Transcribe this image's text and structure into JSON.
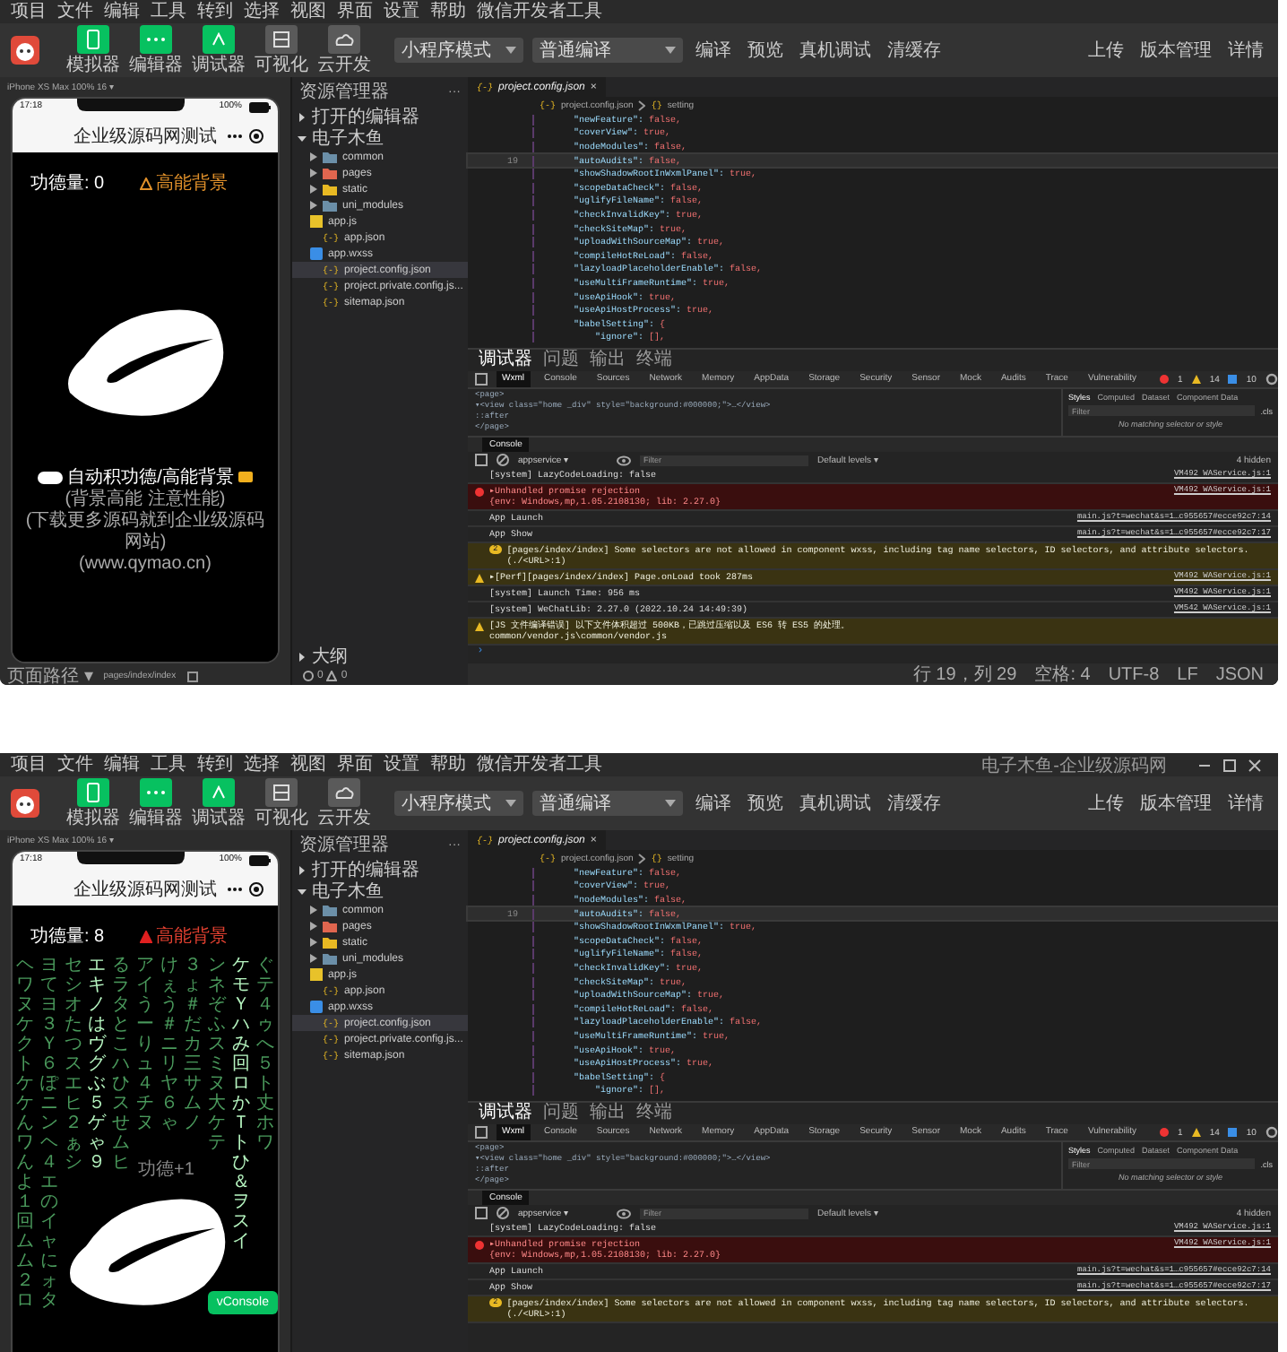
{
  "windows": [
    {
      "menu": [
        "项目",
        "文件",
        "编辑",
        "工具",
        "转到",
        "选择",
        "视图",
        "界面",
        "设置",
        "帮助",
        "微信开发者工具"
      ],
      "tools": [
        {
          "label": "模拟器",
          "on": true
        },
        {
          "label": "编辑器",
          "on": true
        },
        {
          "label": "调试器",
          "on": true
        },
        {
          "label": "可视化",
          "on": false
        },
        {
          "label": "云开发",
          "on": false
        }
      ],
      "mode": "小程序模式",
      "compile": "普通编译",
      "actions": [
        "编译",
        "预览",
        "真机调试",
        "清缓存"
      ],
      "right_actions": [
        "上传",
        "版本管理",
        "详情"
      ],
      "simulator": {
        "device": "iPhone XS Max 100% 16 ▾",
        "time": "17:18",
        "battery": "100%",
        "nav_title": "企业级源码网测试",
        "merit": "功德量: 0",
        "bg_button": "高能背景",
        "caption": "自动积功德/高能背景",
        "caption_lines": [
          "(背景高能 注意性能)",
          "(下载更多源码就到企业级源码网站)",
          "(www.qymao.cn)"
        ],
        "path_label": "页面路径 ▾",
        "path": "pages/index/index"
      },
      "explorer": {
        "title": "资源管理器",
        "more": "···",
        "sections": [
          {
            "label": "打开的编辑器",
            "expanded": false
          },
          {
            "label": "电子木鱼",
            "expanded": true
          }
        ],
        "items": [
          {
            "name": "common",
            "kind": "folder",
            "color": "#6b8fa8",
            "selected": false
          },
          {
            "name": "pages",
            "kind": "folder",
            "color": "#e0664f",
            "selected": false
          },
          {
            "name": "static",
            "kind": "folder",
            "color": "#e8b923",
            "selected": false
          },
          {
            "name": "uni_modules",
            "kind": "folder",
            "color": "#6b8fa8",
            "selected": false
          },
          {
            "name": "app.js",
            "kind": "js",
            "selected": false
          },
          {
            "name": "app.json",
            "kind": "json",
            "glyph": "{-}",
            "selected": false
          },
          {
            "name": "app.wxss",
            "kind": "wxss",
            "selected": false
          },
          {
            "name": "project.config.json",
            "kind": "json",
            "glyph": "{-}",
            "selected": true
          },
          {
            "name": "project.private.config.js...",
            "kind": "json",
            "glyph": "{-}",
            "selected": false
          },
          {
            "name": "sitemap.json",
            "kind": "json",
            "glyph": "{-}",
            "selected": false
          }
        ],
        "outline": "大纲",
        "problems": [
          "0",
          "0"
        ]
      },
      "editor": {
        "tab": {
          "glyph": "{-}",
          "label": "project.config.json",
          "close": "×"
        },
        "breadcrumb": [
          {
            "glyph": "{-}",
            "label": "project.config.json"
          },
          {
            "glyph": "{}",
            "label": "setting"
          }
        ],
        "lines": [
          {
            "key": "\"newFeature\":",
            "value": "false,",
            "current": false
          },
          {
            "key": "\"coverView\":",
            "value": "true,",
            "current": false
          },
          {
            "key": "\"nodeModules\":",
            "value": "false,",
            "current": false
          },
          {
            "key": "\"autoAudits\":",
            "value": "false,",
            "current": true,
            "number": "19"
          },
          {
            "key": "\"showShadowRootInWxmlPanel\":",
            "value": "true,",
            "current": false
          },
          {
            "key": "\"scopeDataCheck\":",
            "value": "false,",
            "current": false
          },
          {
            "key": "\"uglifyFileName\":",
            "value": "false,",
            "current": false
          },
          {
            "key": "\"checkInvalidKey\":",
            "value": "true,",
            "current": false
          },
          {
            "key": "\"checkSiteMap\":",
            "value": "true,",
            "current": false
          },
          {
            "key": "\"uploadWithSourceMap\":",
            "value": "true,",
            "current": false
          },
          {
            "key": "\"compileHotReLoad\":",
            "value": "false,",
            "current": false
          },
          {
            "key": "\"lazyloadPlaceholderEnable\":",
            "value": "false,",
            "current": false
          },
          {
            "key": "\"useMultiFrameRuntime\":",
            "value": "true,",
            "current": false
          },
          {
            "key": "\"useApiHook\":",
            "value": "true,",
            "current": false
          },
          {
            "key": "\"useApiHostProcess\":",
            "value": "true,",
            "current": false
          },
          {
            "key": "\"babelSetting\":",
            "value": "{",
            "current": false,
            "children": [
              {
                "key": "\"ignore\":",
                "value": "[],",
                "current": false
              }
            ]
          }
        ]
      },
      "devtools": {
        "tabs": [
          {
            "label": "调试器",
            "selected": true
          },
          {
            "label": "问题",
            "selected": false
          },
          {
            "label": "输出",
            "selected": false
          },
          {
            "label": "终端",
            "selected": false
          }
        ],
        "panels": [
          {
            "label": "Wxml",
            "selected": true
          },
          {
            "label": "Console",
            "selected": false
          },
          {
            "label": "Sources",
            "selected": false
          },
          {
            "label": "Network",
            "selected": false
          },
          {
            "label": "Memory",
            "selected": false
          },
          {
            "label": "AppData",
            "selected": false
          },
          {
            "label": "Storage",
            "selected": false
          },
          {
            "label": "Security",
            "selected": false
          },
          {
            "label": "Sensor",
            "selected": false
          },
          {
            "label": "Mock",
            "selected": false
          },
          {
            "label": "Audits",
            "selected": false
          },
          {
            "label": "Trace",
            "selected": false
          },
          {
            "label": "Vulnerability",
            "selected": false
          }
        ],
        "counts": [
          "1",
          "14",
          "10"
        ],
        "wxml": [
          "<page>",
          "▾<view class=\"home _div\" style=\"background:#000000;\">…</view>",
          "::after",
          "</page>"
        ],
        "style_tabs": [
          {
            "label": "Styles",
            "selected": true
          },
          {
            "label": "Computed",
            "selected": false
          },
          {
            "label": "Dataset",
            "selected": false
          },
          {
            "label": "Component Data",
            "selected": false
          }
        ],
        "style_filter": {
          "placeholder": "Filter"
        },
        "cls": ".cls",
        "no_match": "No matching selector or style",
        "console_tab": "Console",
        "context": "appservice ▾",
        "filter": {
          "placeholder": "Filter"
        },
        "levels": "Default levels ▾",
        "hidden": "4 hidden",
        "messages": [
          {
            "kind": "info",
            "text": "[system] LazyCodeLoading: false",
            "source": "VM492 WAService.js:1"
          },
          {
            "kind": "error",
            "text": "▸Unhandled promise rejection",
            "detail": "{env: Windows,mp,1.05.2108130; lib: 2.27.0}",
            "source": "VM492 WAService.js:1"
          },
          {
            "kind": "info",
            "text": "App Launch",
            "source": "main.js?t=wechat&s=1…c955657#ecce92c7:14"
          },
          {
            "kind": "info",
            "text": "App Show",
            "source": "main.js?t=wechat&s=1…c955657#ecce92c7:17"
          },
          {
            "kind": "warn",
            "badge": "2",
            "text": "[pages/index/index] Some selectors are not allowed in component wxss, including tag name selectors, ID selectors, and attribute selectors.(./<URL>:1)"
          },
          {
            "kind": "warn",
            "text": "▸[Perf][pages/index/index] Page.onLoad took 287ms",
            "source": "VM492 WAService.js:1"
          },
          {
            "kind": "info",
            "text": "[system] Launch Time: 956 ms",
            "source": "VM492 WAService.js:1"
          },
          {
            "kind": "info",
            "text": "[system] WeChatLib: 2.27.0 (2022.10.24 14:49:39)",
            "source": "VM542 WAService.js:1"
          },
          {
            "kind": "warn",
            "text": "[JS 文件编译错误] 以下文件体积超过 500KB，已跳过压缩以及 ES6 转 ES5 的处理。",
            "detail": "common/vendor.js\\common/vendor.js"
          }
        ],
        "prompt": "›"
      },
      "status": [
        "行 19，列 29",
        "空格: 4",
        "UTF-8",
        "LF",
        "JSON"
      ]
    },
    {
      "menu": [
        "项目",
        "文件",
        "编辑",
        "工具",
        "转到",
        "选择",
        "视图",
        "界面",
        "设置",
        "帮助",
        "微信开发者工具"
      ],
      "title": "电子木鱼-企业级源码网",
      "window_controls": true,
      "tools": [
        {
          "label": "模拟器",
          "on": true
        },
        {
          "label": "编辑器",
          "on": true
        },
        {
          "label": "调试器",
          "on": true
        },
        {
          "label": "可视化",
          "on": false
        },
        {
          "label": "云开发",
          "on": false
        }
      ],
      "mode": "小程序模式",
      "compile": "普通编译",
      "actions": [
        "编译",
        "预览",
        "真机调试",
        "清缓存"
      ],
      "right_actions": [
        "上传",
        "版本管理",
        "详情"
      ],
      "simulator": {
        "device": "iPhone XS Max 100% 16 ▾",
        "time": "17:18",
        "battery": "100%",
        "nav_title": "企业级源码网测试",
        "merit": "功德量: 8",
        "bg_button": "高能背景",
        "floating_text": "功德+1",
        "rain": [
          {
            "chars": "ヘワヌケクトケケんワんよ１回ムム２ロ",
            "bright": false
          },
          {
            "chars": "ヨてヨ３Ｙ６ぽニンヘ４エのイャにォタ",
            "bright": false
          },
          {
            "chars": "セシオたつスエヒ２ぁシ",
            "bright": false
          },
          {
            "chars": "エキノはヴグぶ５ゲゃ９",
            "bright": true
          },
          {
            "chars": "るラタとこハひスせムヒ",
            "bright": false
          },
          {
            "chars": "アイうーりュ４チヌ",
            "bright": false
          },
          {
            "chars": "けぇう＃ニリヤ６ゃ",
            "bright": false
          },
          {
            "chars": "３ょ＃だカ三サムノ",
            "bright": false
          },
          {
            "chars": "ンネぞふスミヌ大ケテ",
            "bright": false
          },
          {
            "chars": "ケモＹハみ回ロかＴトひ＆ヲスイ",
            "bright": true
          },
          {
            "chars": "ぐテ４ゥへ５ト丈ホワ",
            "bright": false
          }
        ],
        "vconsole": "vConsole"
      },
      "explorer": {
        "title": "资源管理器",
        "more": "···",
        "sections": [
          {
            "label": "打开的编辑器",
            "expanded": false
          },
          {
            "label": "电子木鱼",
            "expanded": true
          }
        ],
        "items": [
          {
            "name": "common",
            "kind": "folder",
            "color": "#6b8fa8",
            "selected": false
          },
          {
            "name": "pages",
            "kind": "folder",
            "color": "#e0664f",
            "selected": false
          },
          {
            "name": "static",
            "kind": "folder",
            "color": "#e8b923",
            "selected": false
          },
          {
            "name": "uni_modules",
            "kind": "folder",
            "color": "#6b8fa8",
            "selected": false
          },
          {
            "name": "app.js",
            "kind": "js",
            "selected": false
          },
          {
            "name": "app.json",
            "kind": "json",
            "glyph": "{-}",
            "selected": false
          },
          {
            "name": "app.wxss",
            "kind": "wxss",
            "selected": false
          },
          {
            "name": "project.config.json",
            "kind": "json",
            "glyph": "{-}",
            "selected": true
          },
          {
            "name": "project.private.config.js...",
            "kind": "json",
            "glyph": "{-}",
            "selected": false
          },
          {
            "name": "sitemap.json",
            "kind": "json",
            "glyph": "{-}",
            "selected": false
          }
        ]
      },
      "editor": {
        "tab": {
          "glyph": "{-}",
          "label": "project.config.json",
          "close": "×"
        },
        "breadcrumb": [
          {
            "glyph": "{-}",
            "label": "project.config.json"
          },
          {
            "glyph": "{}",
            "label": "setting"
          }
        ],
        "lines": [
          {
            "key": "\"newFeature\":",
            "value": "false,",
            "current": false
          },
          {
            "key": "\"coverView\":",
            "value": "true,",
            "current": false
          },
          {
            "key": "\"nodeModules\":",
            "value": "false,",
            "current": false
          },
          {
            "key": "\"autoAudits\":",
            "value": "false,",
            "current": true,
            "number": "19"
          },
          {
            "key": "\"showShadowRootInWxmlPanel\":",
            "value": "true,",
            "current": false
          },
          {
            "key": "\"scopeDataCheck\":",
            "value": "false,",
            "current": false
          },
          {
            "key": "\"uglifyFileName\":",
            "value": "false,",
            "current": false
          },
          {
            "key": "\"checkInvalidKey\":",
            "value": "true,",
            "current": false
          },
          {
            "key": "\"checkSiteMap\":",
            "value": "true,",
            "current": false
          },
          {
            "key": "\"uploadWithSourceMap\":",
            "value": "true,",
            "current": false
          },
          {
            "key": "\"compileHotReLoad\":",
            "value": "false,",
            "current": false
          },
          {
            "key": "\"lazyloadPlaceholderEnable\":",
            "value": "false,",
            "current": false
          },
          {
            "key": "\"useMultiFrameRuntime\":",
            "value": "true,",
            "current": false
          },
          {
            "key": "\"useApiHook\":",
            "value": "true,",
            "current": false
          },
          {
            "key": "\"useApiHostProcess\":",
            "value": "true,",
            "current": false
          },
          {
            "key": "\"babelSetting\":",
            "value": "{",
            "current": false,
            "children": [
              {
                "key": "\"ignore\":",
                "value": "[],",
                "current": false
              }
            ]
          }
        ]
      },
      "devtools": {
        "tabs": [
          {
            "label": "调试器",
            "selected": true
          },
          {
            "label": "问题",
            "selected": false
          },
          {
            "label": "输出",
            "selected": false
          },
          {
            "label": "终端",
            "selected": false
          }
        ],
        "panels": [
          {
            "label": "Wxml",
            "selected": true
          },
          {
            "label": "Console",
            "selected": false
          },
          {
            "label": "Sources",
            "selected": false
          },
          {
            "label": "Network",
            "selected": false
          },
          {
            "label": "Memory",
            "selected": false
          },
          {
            "label": "AppData",
            "selected": false
          },
          {
            "label": "Storage",
            "selected": false
          },
          {
            "label": "Security",
            "selected": false
          },
          {
            "label": "Sensor",
            "selected": false
          },
          {
            "label": "Mock",
            "selected": false
          },
          {
            "label": "Audits",
            "selected": false
          },
          {
            "label": "Trace",
            "selected": false
          },
          {
            "label": "Vulnerability",
            "selected": false
          }
        ],
        "counts": [
          "1",
          "14",
          "10"
        ],
        "wxml": [
          "<page>",
          "▾<view class=\"home _div\" style=\"background:#000000;\">…</view>",
          "::after",
          "</page>"
        ],
        "style_tabs": [
          {
            "label": "Styles",
            "selected": true
          },
          {
            "label": "Computed",
            "selected": false
          },
          {
            "label": "Dataset",
            "selected": false
          },
          {
            "label": "Component Data",
            "selected": false
          }
        ],
        "style_filter": {
          "placeholder": "Filter"
        },
        "cls": ".cls",
        "no_match": "No matching selector or style",
        "console_tab": "Console",
        "context": "appservice ▾",
        "filter": {
          "placeholder": "Filter"
        },
        "levels": "Default levels ▾",
        "hidden": "4 hidden",
        "messages": [
          {
            "kind": "info",
            "text": "[system] LazyCodeLoading: false",
            "source": "VM492 WAService.js:1"
          },
          {
            "kind": "error",
            "text": "▸Unhandled promise rejection",
            "detail": "{env: Windows,mp,1.05.2108130; lib: 2.27.0}",
            "source": "VM492 WAService.js:1"
          },
          {
            "kind": "info",
            "text": "App Launch",
            "source": "main.js?t=wechat&s=1…c955657#ecce92c7:14"
          },
          {
            "kind": "info",
            "text": "App Show",
            "source": "main.js?t=wechat&s=1…c955657#ecce92c7:17"
          },
          {
            "kind": "warn",
            "badge": "2",
            "text": "[pages/index/index] Some selectors are not allowed in component wxss, including tag name selectors, ID selectors, and attribute selectors.(./<URL>:1)"
          }
        ]
      }
    }
  ]
}
